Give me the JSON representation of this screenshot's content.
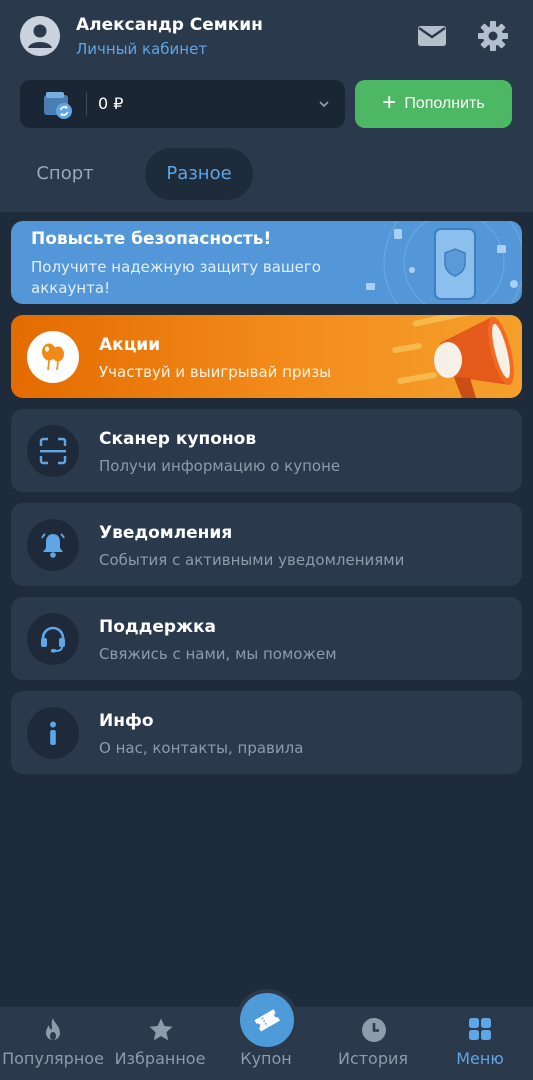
{
  "header": {
    "user_name": "Александр Семкин",
    "subtitle": "Личный кабинет",
    "icons": [
      "avatar-icon",
      "mail-icon",
      "gear-icon"
    ]
  },
  "wallet": {
    "balance": "0 ₽",
    "topup_label": "Пополнить"
  },
  "tabs": [
    {
      "label": "Спорт",
      "active": false
    },
    {
      "label": "Разное",
      "active": true
    }
  ],
  "security_card": {
    "title": "Повысьте безопасность!",
    "text": "Получите надежную защиту вашего аккаунта!"
  },
  "promo_card": {
    "title": "Акции",
    "subtitle": "Участвуй и выигрывай призы"
  },
  "menu": [
    {
      "title": "Сканер купонов",
      "subtitle": "Получи информацию о купоне",
      "icon": "scanner-icon"
    },
    {
      "title": "Уведомления",
      "subtitle": "События с активными уведомлениями",
      "icon": "bell-icon"
    },
    {
      "title": "Поддержка",
      "subtitle": "Свяжись с нами, мы поможем",
      "icon": "headset-icon"
    },
    {
      "title": "Инфо",
      "subtitle": "О нас, контакты, правила",
      "icon": "info-icon"
    }
  ],
  "bottom_nav": [
    {
      "label": "Популярное",
      "icon": "fire-icon"
    },
    {
      "label": "Избранное",
      "icon": "star-icon"
    },
    {
      "label": "Купон",
      "icon": "ticket-icon"
    },
    {
      "label": "История",
      "icon": "clock-icon"
    },
    {
      "label": "Меню",
      "icon": "grid-icon",
      "active": true
    }
  ],
  "colors": {
    "background": "#1e2b3b",
    "panel": "#2a394c",
    "accent_blue": "#5ea6e6",
    "green": "#4cb863",
    "orange": "#f38c1c"
  }
}
